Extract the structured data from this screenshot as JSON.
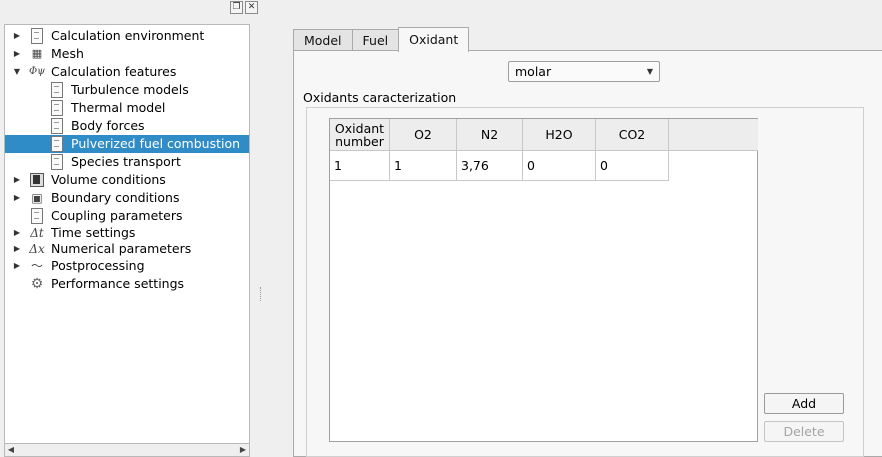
{
  "dock": {
    "float_icon": "float-icon",
    "close_icon": "close-icon"
  },
  "tree": {
    "items": [
      {
        "label": "Calculation environment",
        "icon": "document-icon"
      },
      {
        "label": "Mesh",
        "icon": "mesh-icon"
      },
      {
        "label": "Calculation features",
        "icon": "phi-icon"
      },
      {
        "label": "Turbulence models",
        "icon": "document-icon"
      },
      {
        "label": "Thermal model",
        "icon": "document-icon"
      },
      {
        "label": "Body forces",
        "icon": "document-icon"
      },
      {
        "label": "Pulverized fuel combustion",
        "icon": "document-icon"
      },
      {
        "label": "Species transport",
        "icon": "document-icon"
      },
      {
        "label": "Volume conditions",
        "icon": "volume-icon"
      },
      {
        "label": "Boundary conditions",
        "icon": "boundary-icon"
      },
      {
        "label": "Coupling parameters",
        "icon": "document-icon"
      },
      {
        "label": "Time settings",
        "icon": "delta-t-icon"
      },
      {
        "label": "Numerical parameters",
        "icon": "delta-x-icon"
      },
      {
        "label": "Postprocessing",
        "icon": "chart-icon"
      },
      {
        "label": "Performance settings",
        "icon": "gear-icon"
      }
    ],
    "selected": "Pulverized fuel combustion"
  },
  "tabs": [
    {
      "label": "Model"
    },
    {
      "label": "Fuel"
    },
    {
      "label": "Oxidant"
    }
  ],
  "active_tab": "Oxidant",
  "composition_select": {
    "value": "molar"
  },
  "oxidants": {
    "title": "Oxidants caracterization",
    "columns": [
      "Oxidant\nnumber",
      "O2",
      "N2",
      "H2O",
      "CO2"
    ],
    "rows": [
      [
        "1",
        "1",
        "3,76",
        "0",
        "0"
      ]
    ]
  },
  "buttons": {
    "add": "Add",
    "delete": "Delete"
  }
}
